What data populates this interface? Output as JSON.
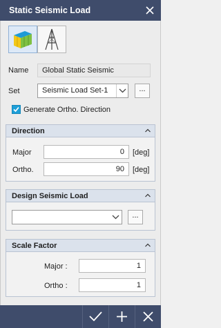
{
  "window": {
    "title": "Static Seismic Load"
  },
  "toolbar": {
    "icons": [
      "building-load-icon",
      "tower-structure-icon"
    ]
  },
  "name": {
    "label": "Name",
    "value": "Global Static Seismic"
  },
  "set": {
    "label": "Set",
    "value": "Seismic Load Set-1",
    "browse_label": "..."
  },
  "generate_ortho": {
    "label": "Generate Ortho. Direction",
    "checked": true
  },
  "direction": {
    "title": "Direction",
    "major_label": "Major",
    "major_value": "0",
    "major_unit": "[deg]",
    "ortho_label": "Ortho.",
    "ortho_value": "90",
    "ortho_unit": "[deg]"
  },
  "design_seismic_load": {
    "title": "Design Seismic Load",
    "value": "",
    "browse_label": "..."
  },
  "scale_factor": {
    "title": "Scale Factor",
    "major_label": "Major :",
    "major_value": "1",
    "ortho_label": "Ortho :",
    "ortho_value": "1"
  },
  "footer": {
    "buttons": [
      "ok-icon",
      "add-icon",
      "close-icon"
    ]
  },
  "colors": {
    "titlebar": "#3f4c6b",
    "accent": "#1e9fd8",
    "group_header": "#dbe2ec"
  }
}
